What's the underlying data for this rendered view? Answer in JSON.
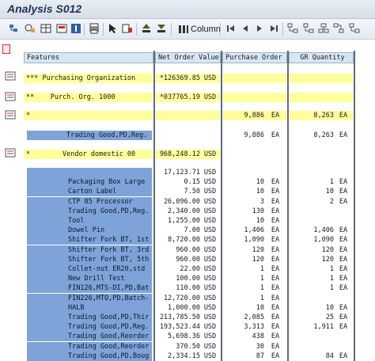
{
  "window": {
    "title": "Analysis S012"
  },
  "toolbar": {
    "column_label": "Column",
    "icons": [
      "expand-icon",
      "hierarchy-icon",
      "grid-icon",
      "sum-icon",
      "info-icon",
      "print-icon",
      "select-icon",
      "filter-icon",
      "sort-up-icon",
      "sort-down-icon",
      "column-icon",
      "first-page-icon",
      "prev-page-icon",
      "next-page-icon",
      "last-page-icon",
      "tree-icon"
    ]
  },
  "columns": {
    "features": "Features",
    "net_order_value": "Net Order Value",
    "purchase_order": "Purchase Order",
    "gr_quantity": "GR Quantity"
  },
  "rows": [
    {
      "feature": "*** Purchasing Organization",
      "value": "*126369.85",
      "vunit": "USD",
      "po": "",
      "pounit": "",
      "gr": "",
      "grunit": ""
    },
    {
      "feature": "**    Purch. Org. 1000",
      "value": "*037765.19",
      "vunit": "USD",
      "po": "",
      "pounit": "",
      "gr": "",
      "grunit": ""
    },
    {
      "feature": "*",
      "value": "",
      "vunit": "",
      "po": "9,886",
      "pounit": "EA",
      "gr": "8,263",
      "grunit": "EA"
    },
    {
      "feature": "Trading Good,PD,Reg.",
      "value": "",
      "vunit": "",
      "po": "9,886",
      "pounit": "EA",
      "gr": "8,263",
      "grunit": "EA"
    },
    {
      "feature": "*        Vendor domestic 00",
      "value": "968,248.12",
      "vunit": "USD",
      "po": "",
      "pounit": "",
      "gr": "",
      "grunit": ""
    }
  ],
  "detail_rows": [
    {
      "feature": "",
      "value": "17,123.71",
      "vunit": "USD",
      "po": "",
      "pounit": "",
      "gr": "",
      "grunit": ""
    },
    {
      "feature": "Packaging Box Large",
      "value": "0.15",
      "vunit": "USD",
      "po": "10",
      "pounit": "EA",
      "gr": "1",
      "grunit": "EA"
    },
    {
      "feature": "Carton Label",
      "value": "7.50",
      "vunit": "USD",
      "po": "10",
      "pounit": "EA",
      "gr": "10",
      "grunit": "EA"
    },
    {
      "feature": "CTP 85 Processor",
      "value": "26,096.00",
      "vunit": "USD",
      "po": "3",
      "pounit": "EA",
      "gr": "2",
      "grunit": "EA"
    },
    {
      "feature": "Trading Good,PD,Reg.",
      "value": "2,340.00",
      "vunit": "USD",
      "po": "130",
      "pounit": "EA",
      "gr": "",
      "grunit": ""
    },
    {
      "feature": "Tool",
      "value": "1,255.00",
      "vunit": "USD",
      "po": "10",
      "pounit": "EA",
      "gr": "",
      "grunit": ""
    },
    {
      "feature": "Dowel Pin",
      "value": "7.00",
      "vunit": "USD",
      "po": "1,406",
      "pounit": "EA",
      "gr": "1,406",
      "grunit": "EA"
    },
    {
      "feature": "Shifter Fork BT, 1st",
      "value": "8,720.00",
      "vunit": "USD",
      "po": "1,090",
      "pounit": "EA",
      "gr": "1,090",
      "grunit": "EA"
    },
    {
      "feature": "Shifter Fork BT, 3rd",
      "value": "960.00",
      "vunit": "USD",
      "po": "120",
      "pounit": "EA",
      "gr": "120",
      "grunit": "EA"
    },
    {
      "feature": "Shifter Fork BT, 5th",
      "value": "960.00",
      "vunit": "USD",
      "po": "120",
      "pounit": "EA",
      "gr": "120",
      "grunit": "EA"
    },
    {
      "feature": "Collet-nut ER20,std",
      "value": "22.00",
      "vunit": "USD",
      "po": "1",
      "pounit": "EA",
      "gr": "1",
      "grunit": "EA"
    },
    {
      "feature": "New Drill Test",
      "value": "100.00",
      "vunit": "USD",
      "po": "1",
      "pounit": "EA",
      "gr": "1",
      "grunit": "EA"
    },
    {
      "feature": "FIN126,MTS-DI,PD,Bat",
      "value": "110.00",
      "vunit": "USD",
      "po": "1",
      "pounit": "EA",
      "gr": "1",
      "grunit": "EA"
    },
    {
      "feature": "FIN226,MTO,PD,Batch-",
      "value": "12,720.00",
      "vunit": "USD",
      "po": "1",
      "pounit": "EA",
      "gr": "",
      "grunit": ""
    },
    {
      "feature": "HALB",
      "value": "1,000.00",
      "vunit": "USD",
      "po": "10",
      "pounit": "EA",
      "gr": "10",
      "grunit": "EA"
    },
    {
      "feature": "Trading Good,PD,Thir",
      "value": "213,785.50",
      "vunit": "USD",
      "po": "2,085",
      "pounit": "EA",
      "gr": "25",
      "grunit": "EA"
    },
    {
      "feature": "Trading Good,PD,Reg.",
      "value": "193,523.44",
      "vunit": "USD",
      "po": "3,313",
      "pounit": "EA",
      "gr": "1,911",
      "grunit": "EA"
    },
    {
      "feature": "Trading Good,Reorder",
      "value": "5,698.36",
      "vunit": "USD",
      "po": "438",
      "pounit": "EA",
      "gr": "",
      "grunit": ""
    },
    {
      "feature": "Trading Good,Reorder",
      "value": "370.50",
      "vunit": "USD",
      "po": "30",
      "pounit": "EA",
      "gr": "",
      "grunit": ""
    },
    {
      "feature": "Trading Good,PD,Boug",
      "value": "2,334.15",
      "vunit": "USD",
      "po": "87",
      "pounit": "EA",
      "gr": "84",
      "grunit": "EA"
    }
  ],
  "colors": {
    "highlight_yellow": "#ffff99",
    "selection_blue": "#7da3d9",
    "header_blue": "#d7e6f4"
  }
}
